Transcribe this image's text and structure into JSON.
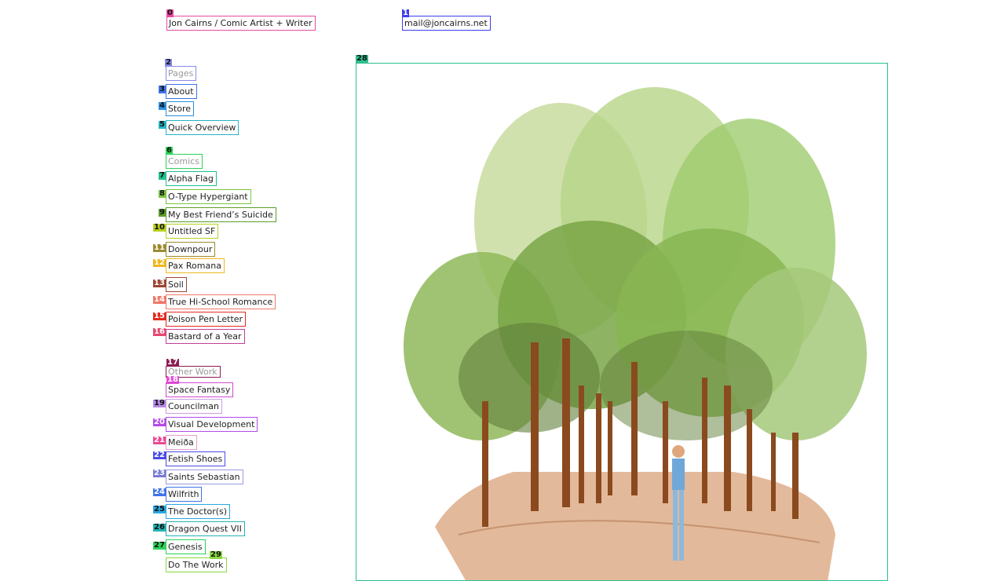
{
  "header": {
    "site_title": "Jon Cairns / Comic Artist + Writer",
    "email": "mail@joncairns.net"
  },
  "sidebar": {
    "pages_heading": "Pages",
    "pages": [
      "About",
      "Store",
      "Quick Overview"
    ],
    "comics_heading": "Comics",
    "comics": [
      "Alpha Flag",
      "O-Type Hypergiant",
      "My Best Friend’s Suicide",
      "Untitled SF",
      "Downpour",
      "Pax Romana",
      "Soil",
      "True Hi-School Romance",
      "Poison Pen Letter",
      "Bastard of a Year"
    ],
    "other_heading": "Other Work",
    "other": [
      "Space Fantasy",
      "Councilman",
      "Visual Development",
      "Meiða",
      "Fetish Shoes",
      "Saints Sebastian",
      "Wilfrith",
      "The Doctor(s)",
      "Dragon Quest VII",
      "Genesis",
      "Do The Work"
    ]
  },
  "marks": [
    "0",
    "1",
    "2",
    "3",
    "4",
    "5",
    "6",
    "7",
    "8",
    "9",
    "10",
    "11",
    "12",
    "13",
    "14",
    "15",
    "16",
    "17",
    "18",
    "19",
    "20",
    "21",
    "22",
    "23",
    "24",
    "25",
    "26",
    "27",
    "28",
    "29"
  ],
  "colors": {
    "frame": "#2fbf8f"
  }
}
